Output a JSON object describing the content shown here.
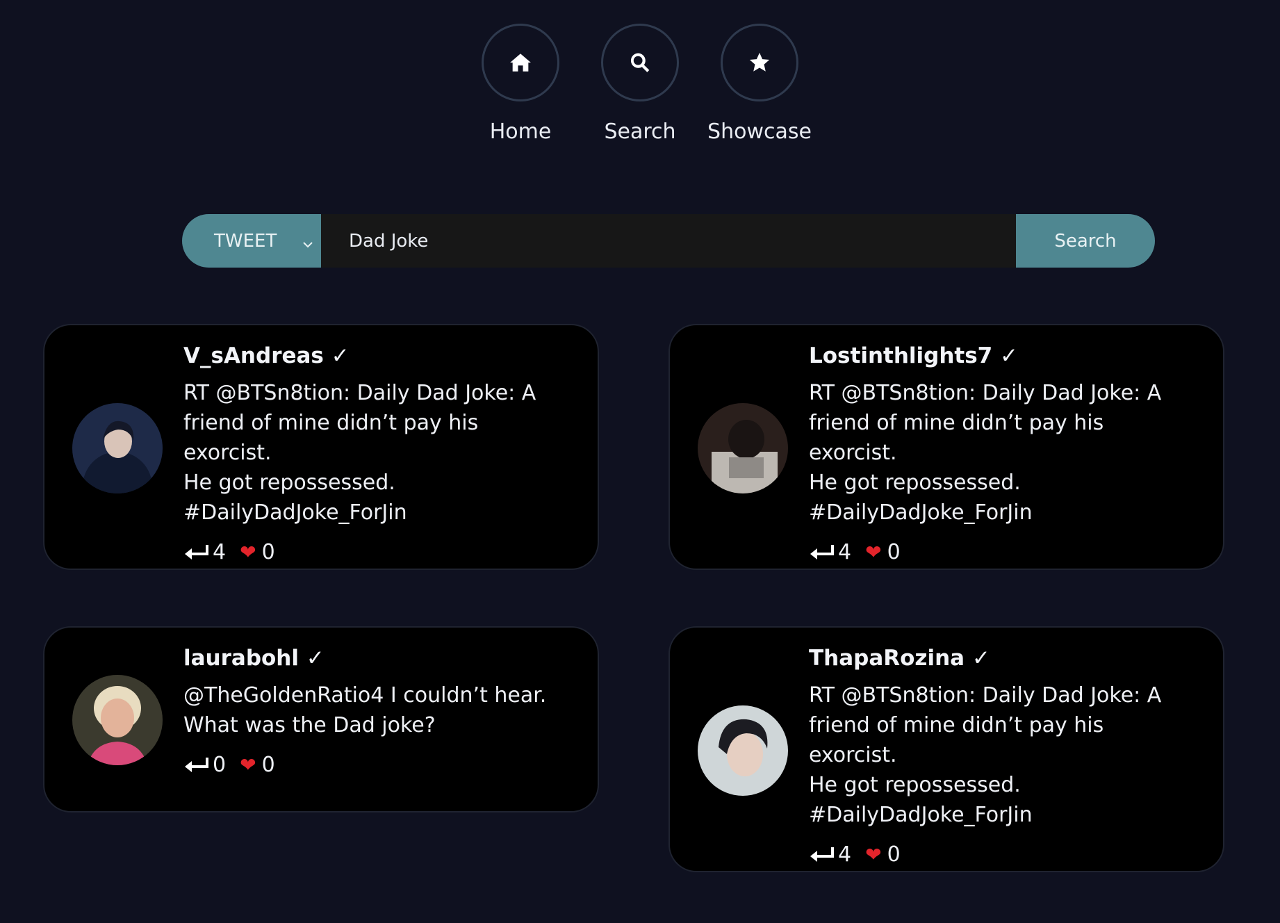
{
  "nav": {
    "items": [
      {
        "label": "Home",
        "icon": "home-icon"
      },
      {
        "label": "Search",
        "icon": "search-icon"
      },
      {
        "label": "Showcase",
        "icon": "star-icon"
      }
    ]
  },
  "search": {
    "type_selected": "TWEET",
    "query_value": "Dad Joke",
    "button_label": "Search"
  },
  "colors": {
    "background": "#0f1120",
    "accent": "#4f8791",
    "card": "#000000"
  },
  "tweets": [
    {
      "username": "V_sAndreas ✓",
      "text": "RT @BTSn8tion: Daily Dad Joke: A\nfriend of mine didn’t pay his exorcist.\nHe got repossessed.\n#DailyDadJoke_ForJin",
      "retweets": "4",
      "likes": "0"
    },
    {
      "username": "Lostinthlights7 ✓",
      "text": "RT @BTSn8tion: Daily Dad Joke: A\nfriend of mine didn’t pay his exorcist.\nHe got repossessed.\n#DailyDadJoke_ForJin",
      "retweets": "4",
      "likes": "0"
    },
    {
      "username": "laurabohl ✓",
      "text": "@TheGoldenRatio4 I couldn’t hear.\nWhat was the Dad joke?",
      "retweets": "0",
      "likes": "0"
    },
    {
      "username": "ThapaRozina ✓",
      "text": "RT @BTSn8tion: Daily Dad Joke: A\nfriend of mine didn’t pay his exorcist.\nHe got repossessed.\n#DailyDadJoke_ForJin",
      "retweets": "4",
      "likes": "0"
    }
  ]
}
